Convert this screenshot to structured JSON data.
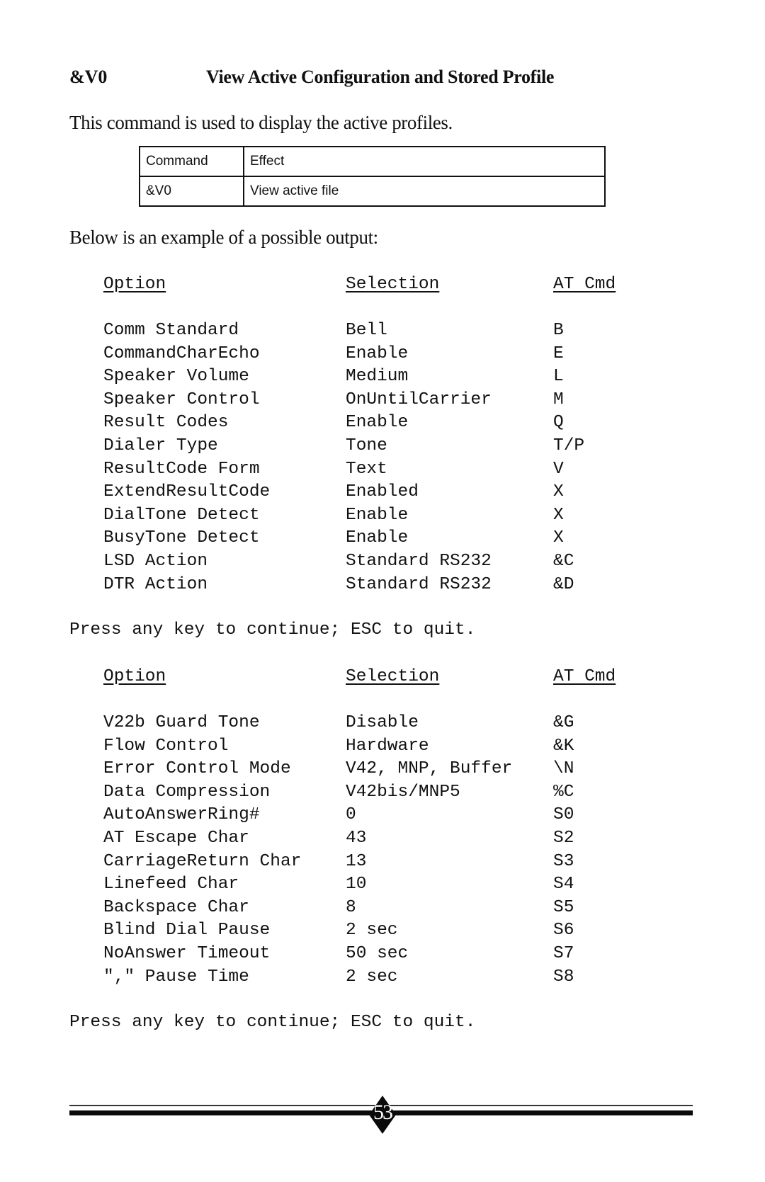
{
  "heading": {
    "command": "&V0",
    "title": "View Active Configuration and Stored Profile"
  },
  "intro": "This command is used to display the active profiles.",
  "command_table": {
    "headers": [
      "Command",
      "Effect"
    ],
    "rows": [
      [
        "&V0",
        "View active file"
      ]
    ]
  },
  "below_text": "Below is an example of a possible output:",
  "output_page_1": {
    "headers": [
      "Option",
      "Selection",
      "AT Cmd"
    ],
    "rows": [
      [
        "Comm Standard",
        "Bell",
        "B"
      ],
      [
        "CommandCharEcho",
        "Enable",
        "E"
      ],
      [
        "Speaker Volume",
        "Medium",
        "L"
      ],
      [
        "Speaker Control",
        "OnUntilCarrier",
        "M"
      ],
      [
        "Result Codes",
        "Enable",
        "Q"
      ],
      [
        "Dialer Type",
        "Tone",
        "T/P"
      ],
      [
        "ResultCode Form",
        "Text",
        "V"
      ],
      [
        "ExtendResultCode",
        "Enabled",
        "X"
      ],
      [
        "DialTone Detect",
        "Enable",
        "X"
      ],
      [
        "BusyTone Detect",
        "Enable",
        "X"
      ],
      [
        "LSD Action",
        "Standard RS232",
        "&C"
      ],
      [
        "DTR Action",
        "Standard RS232",
        "&D"
      ]
    ],
    "prompt": "Press any key to continue; ESC to quit."
  },
  "output_page_2": {
    "headers": [
      "Option",
      "Selection",
      "AT Cmd"
    ],
    "rows": [
      [
        "V22b Guard Tone",
        "Disable",
        "&G"
      ],
      [
        "Flow Control",
        "Hardware",
        "&K"
      ],
      [
        "Error Control Mode",
        "V42, MNP, Buffer",
        "\\N"
      ],
      [
        "Data Compression",
        "V42bis/MNP5",
        "%C"
      ],
      [
        "AutoAnswerRing#",
        "0",
        "S0"
      ],
      [
        "AT Escape Char",
        "43",
        "S2"
      ],
      [
        "CarriageReturn Char",
        "13",
        "S3"
      ],
      [
        "Linefeed Char",
        "10",
        "S4"
      ],
      [
        "Backspace Char",
        "8",
        "S5"
      ],
      [
        "Blind Dial Pause",
        "2 sec",
        "S6"
      ],
      [
        "NoAnswer Timeout",
        "50 sec",
        "S7"
      ],
      [
        "\",\" Pause Time",
        "2 sec",
        "S8"
      ]
    ],
    "prompt": "Press any key to continue; ESC to quit."
  },
  "footer": {
    "page_number": "53"
  }
}
